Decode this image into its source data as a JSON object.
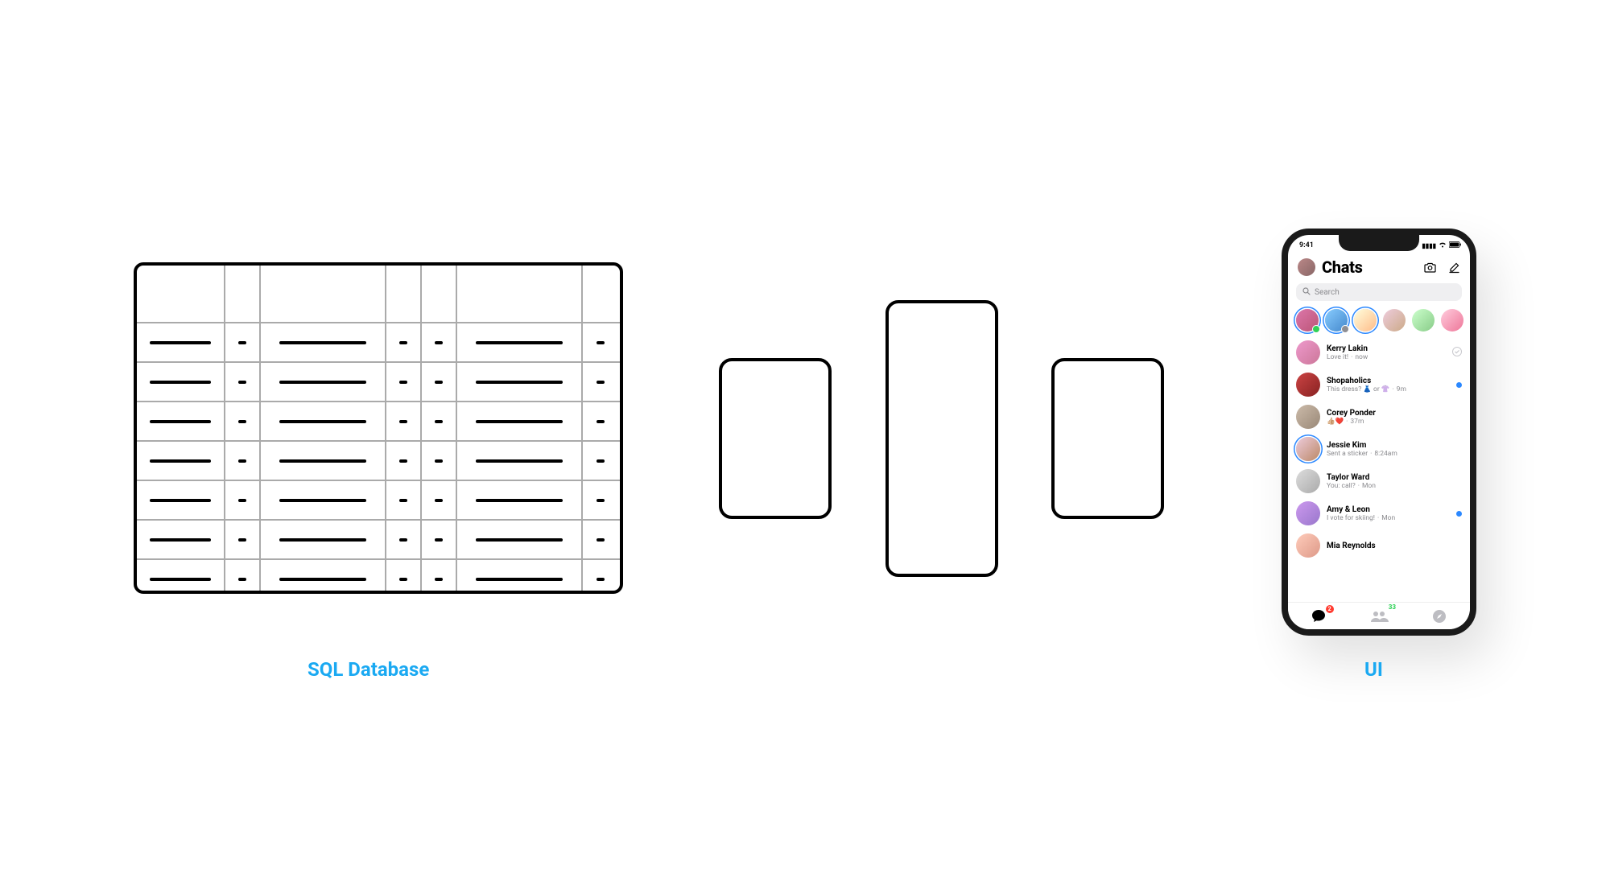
{
  "labels": {
    "db": "SQL Database",
    "ui": "UI"
  },
  "phone": {
    "status_time": "9:41",
    "header_title": "Chats",
    "search_placeholder": "Search",
    "stories": [
      {
        "ring": true,
        "corner_color": "#30d158",
        "bg": "linear-gradient(135deg,#d7a,#b57)"
      },
      {
        "ring": true,
        "corner_color": "#8e8e93",
        "bg": "linear-gradient(135deg,#8cf,#48c)"
      },
      {
        "ring": true,
        "corner_color": null,
        "bg": "linear-gradient(135deg,#ffd,#fb8)"
      },
      {
        "ring": false,
        "corner_color": null,
        "bg": "linear-gradient(135deg,#ecd,#ca8)"
      },
      {
        "ring": false,
        "corner_color": null,
        "bg": "linear-gradient(135deg,#cfc,#8c8)"
      },
      {
        "ring": false,
        "corner_color": null,
        "bg": "linear-gradient(135deg,#fcd,#e79)"
      }
    ],
    "chats": [
      {
        "name": "Kerry Lakin",
        "sub": "Love it!",
        "time": "now",
        "ring": false,
        "right": "check",
        "avatar_bg": "linear-gradient(135deg,#e9c,#c79)"
      },
      {
        "name": "Shopaholics",
        "sub": "This dress? 👗 or 👚",
        "time": "9m",
        "ring": false,
        "right": "blue",
        "avatar_bg": "linear-gradient(135deg,#c44,#822)"
      },
      {
        "name": "Corey Ponder",
        "sub": "👍🏼❤️",
        "time": "37m",
        "ring": false,
        "right": "",
        "avatar_bg": "linear-gradient(135deg,#cba,#987)"
      },
      {
        "name": "Jessie Kim",
        "sub": "Sent a sticker",
        "time": "8:24am",
        "ring": true,
        "right": "",
        "avatar_bg": "linear-gradient(135deg,#ecd,#b86)"
      },
      {
        "name": "Taylor Ward",
        "sub": "You: call?",
        "time": "Mon",
        "ring": false,
        "right": "",
        "avatar_bg": "linear-gradient(135deg,#ddd,#aaa)"
      },
      {
        "name": "Amy & Leon",
        "sub": "I vote for skiing!",
        "time": "Mon",
        "ring": false,
        "right": "blue",
        "avatar_bg": "linear-gradient(135deg,#c9e,#97c)"
      },
      {
        "name": "Mia Reynolds",
        "sub": "",
        "time": "",
        "ring": false,
        "right": "",
        "avatar_bg": "linear-gradient(135deg,#fcb,#d98)"
      }
    ],
    "tab_badge": "2",
    "tab_people_count": "33"
  },
  "colors": {
    "accent_label": "#1aa9f2",
    "blue_dot": "#2b88ff"
  }
}
